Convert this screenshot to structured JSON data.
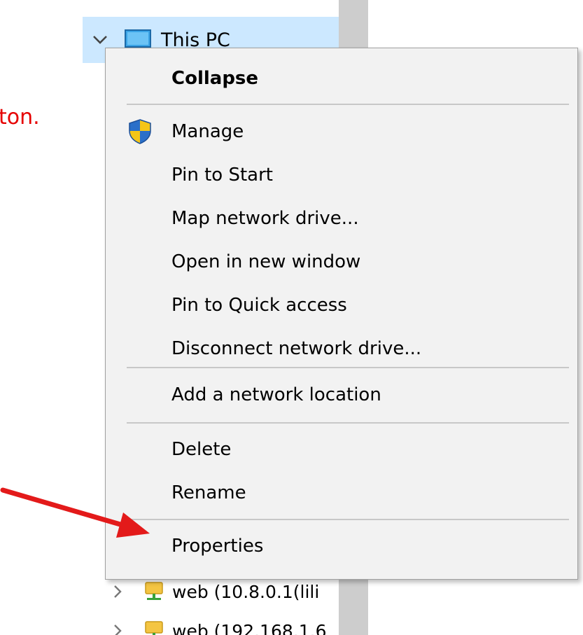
{
  "instruction": {
    "text": "ton.",
    "color": "#e60000"
  },
  "tree": {
    "selected_item": {
      "label": "This PC",
      "icon": "computer-icon",
      "expanded": true,
      "highlight_color": "#cce8ff"
    },
    "lower_items": [
      {
        "label": "web (10.8.0.1(lili",
        "icon": "network-drive-icon"
      },
      {
        "label": "web (192.168.1.6",
        "icon": "network-drive-icon"
      }
    ]
  },
  "context_menu": {
    "background": "#f2f2f2",
    "items": [
      {
        "label": "Collapse",
        "bold": true
      },
      {
        "label": "Manage",
        "icon": "uac-shield-icon"
      },
      {
        "label": "Pin to Start"
      },
      {
        "label": "Map network drive..."
      },
      {
        "label": "Open in new window"
      },
      {
        "label": "Pin to Quick access"
      },
      {
        "label": "Disconnect network drive..."
      },
      {
        "label": "Add a network location"
      },
      {
        "label": "Delete"
      },
      {
        "label": "Rename"
      },
      {
        "label": "Properties"
      }
    ]
  },
  "annotation": {
    "arrow_color": "#e31a1a",
    "points_to": "Properties"
  }
}
